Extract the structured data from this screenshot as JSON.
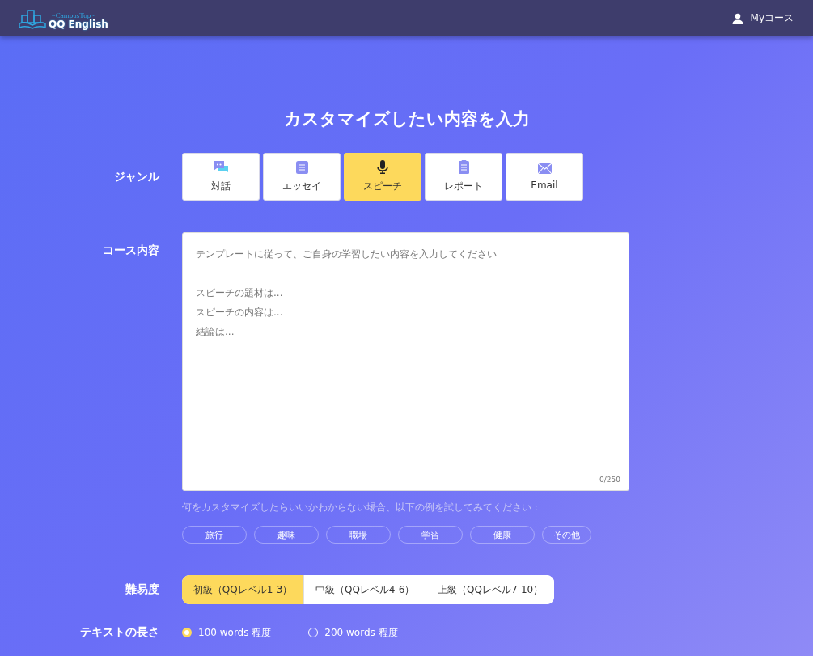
{
  "header": {
    "logo_tagline": "~CampusTop~",
    "logo_name": "QQ English",
    "user_link": "Myコース"
  },
  "title": "カスタマイズしたい内容を入力",
  "genre": {
    "label": "ジャンル",
    "tabs": [
      {
        "label": "対話",
        "kind": "chat",
        "selected": false
      },
      {
        "label": "エッセイ",
        "kind": "essay",
        "selected": false
      },
      {
        "label": "スピーチ",
        "kind": "speech",
        "selected": true
      },
      {
        "label": "レポート",
        "kind": "report",
        "selected": false
      },
      {
        "label": "Email",
        "kind": "email",
        "selected": false
      }
    ]
  },
  "content": {
    "label": "コース内容",
    "placeholder_lines": [
      "テンプレートに従って、ご自身の学習したい内容を入力してください",
      "スピーチの題材は...",
      "スピーチの内容は...",
      "結論は..."
    ],
    "counter": "0/250",
    "hint": "何をカスタマイズしたらいいかわからない場合、以下の例を試してみてください：",
    "examples": [
      "旅行",
      "趣味",
      "職場",
      "学習",
      "健康",
      "その他"
    ]
  },
  "difficulty": {
    "label": "難易度",
    "options": [
      {
        "label": "初級（QQレベル1-3）",
        "selected": true
      },
      {
        "label": "中級（QQレベル4-6）",
        "selected": false
      },
      {
        "label": "上級（QQレベル7-10）",
        "selected": false
      }
    ]
  },
  "length": {
    "label": "テキストの長さ",
    "options": [
      {
        "label": "100 words 程度",
        "selected": true
      },
      {
        "label": "200 words 程度",
        "selected": false
      }
    ]
  }
}
